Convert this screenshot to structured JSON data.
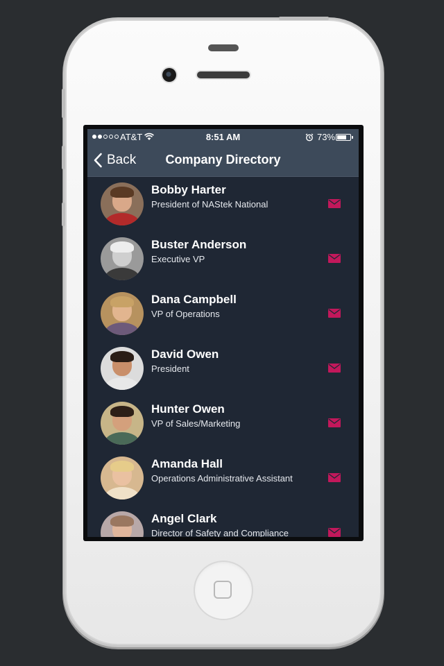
{
  "status_bar": {
    "carrier": "AT&T",
    "time": "8:51 AM",
    "battery": "73%",
    "battery_level": 0.73,
    "signal_bars": 2
  },
  "nav": {
    "back_label": "Back",
    "title": "Company Directory"
  },
  "colors": {
    "background": "#2a2d30",
    "screen": "#1f2734",
    "header": "#3d4a5a",
    "mail_accent": "#c2185b"
  },
  "employees": [
    {
      "name": "Bobby Harter",
      "title": "President of NAStek National",
      "avatar": "avatar-photo",
      "mail_icon": "envelope-icon"
    },
    {
      "name": "Buster Anderson",
      "title": "Executive VP",
      "avatar": "avatar-photo",
      "mail_icon": "envelope-icon"
    },
    {
      "name": "Dana Campbell",
      "title": "VP of Operations",
      "avatar": "avatar-photo",
      "mail_icon": "envelope-icon"
    },
    {
      "name": "David Owen",
      "title": "President",
      "avatar": "avatar-photo",
      "mail_icon": "envelope-icon"
    },
    {
      "name": "Hunter Owen",
      "title": "VP of Sales/Marketing",
      "avatar": "avatar-photo",
      "mail_icon": "envelope-icon"
    },
    {
      "name": "Amanda Hall",
      "title": "Operations Administrative Assistant",
      "avatar": "avatar-photo",
      "mail_icon": "envelope-icon"
    },
    {
      "name": "Angel Clark",
      "title": "Director of Safety and Compliance",
      "avatar": "avatar-photo",
      "mail_icon": "envelope-icon"
    }
  ]
}
